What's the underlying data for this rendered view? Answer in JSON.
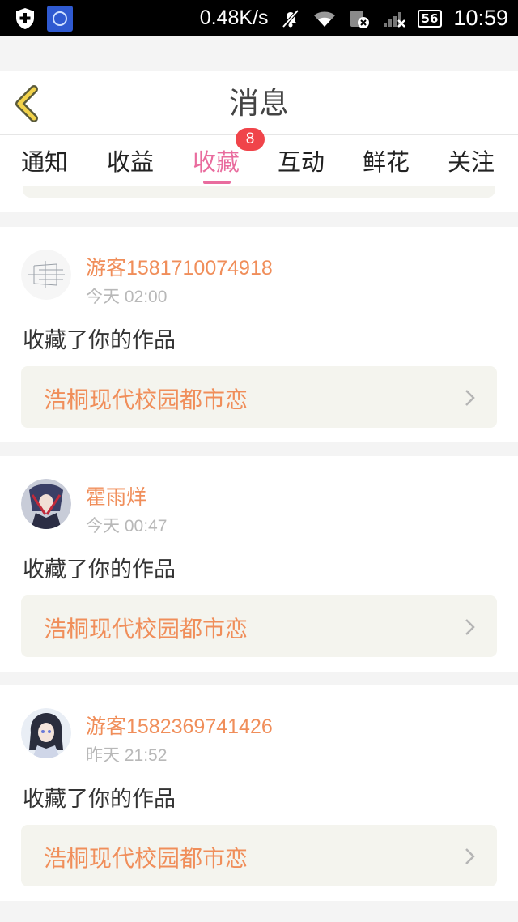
{
  "status_bar": {
    "speed": "0.48K/s",
    "battery": "56",
    "time": "10:59"
  },
  "header": {
    "title": "消息"
  },
  "tabs": [
    {
      "label": "通知"
    },
    {
      "label": "收益"
    },
    {
      "label": "收藏",
      "active": true,
      "badge": "8"
    },
    {
      "label": "互动"
    },
    {
      "label": "鲜花"
    },
    {
      "label": "关注"
    }
  ],
  "messages": [
    {
      "username": "游客1581710074918",
      "time": "今天 02:00",
      "action": "收藏了你的作品",
      "work": "浩桐现代校园都市恋"
    },
    {
      "username": "霍雨烊",
      "time": "今天 00:47",
      "action": "收藏了你的作品",
      "work": "浩桐现代校园都市恋"
    },
    {
      "username": "游客1582369741426",
      "time": "昨天 21:52",
      "action": "收藏了你的作品",
      "work": "浩桐现代校园都市恋"
    }
  ],
  "colors": {
    "accent": "#e96c9e",
    "username": "#f08e5a",
    "badge": "#f0444a"
  }
}
